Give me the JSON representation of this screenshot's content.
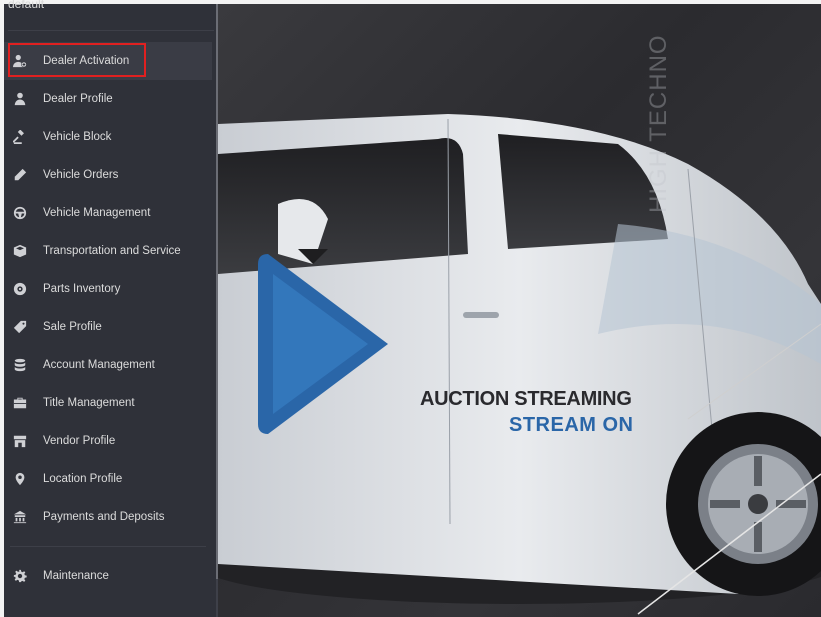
{
  "sidebar": {
    "workspace_label": "default",
    "items": [
      {
        "label": "Dealer Activation",
        "icon": "user-add-icon"
      },
      {
        "label": "Dealer Profile",
        "icon": "user-icon"
      },
      {
        "label": "Vehicle Block",
        "icon": "gavel-icon"
      },
      {
        "label": "Vehicle Orders",
        "icon": "pencil-icon"
      },
      {
        "label": "Vehicle Management",
        "icon": "steering-wheel-icon"
      },
      {
        "label": "Transportation and Service",
        "icon": "cube-icon"
      },
      {
        "label": "Parts Inventory",
        "icon": "gear-icon"
      },
      {
        "label": "Sale Profile",
        "icon": "tag-icon"
      },
      {
        "label": "Account Management",
        "icon": "database-icon"
      },
      {
        "label": "Title Management",
        "icon": "briefcase-icon"
      },
      {
        "label": "Vendor Profile",
        "icon": "store-icon"
      },
      {
        "label": "Location Profile",
        "icon": "map-marker-icon"
      },
      {
        "label": "Payments and Deposits",
        "icon": "bank-icon"
      }
    ],
    "maintenance": {
      "label": "Maintenance",
      "icon": "cog-icon"
    },
    "active_index": 0
  },
  "hero": {
    "vertical_text": "HIGH TECHNO",
    "brand_line1_a": "AUCTION",
    "brand_line1_b": "STREAMING",
    "brand_line2": "STREAM ON",
    "colors": {
      "accent_blue": "#2a66a8",
      "highlight_red": "#e02020"
    }
  }
}
